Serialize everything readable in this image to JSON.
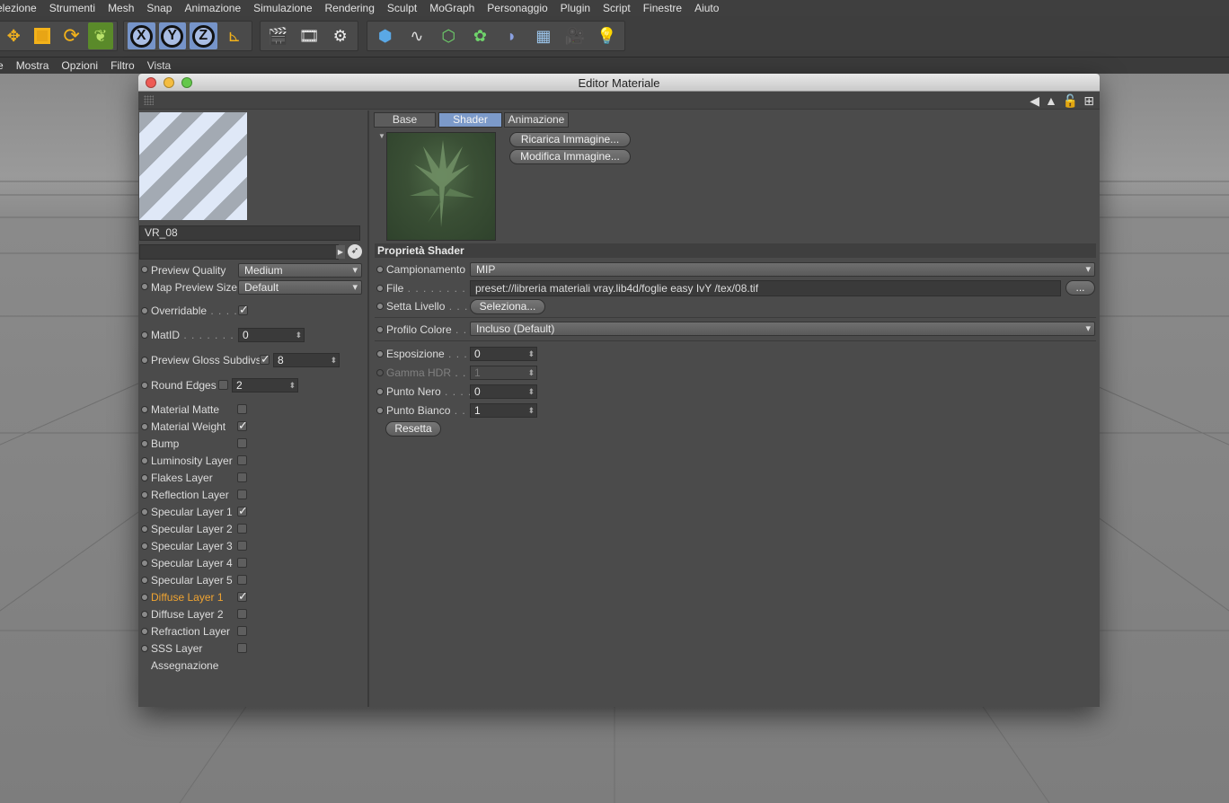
{
  "menubar": [
    "elezione",
    "Strumenti",
    "Mesh",
    "Snap",
    "Animazione",
    "Simulazione",
    "Rendering",
    "Sculpt",
    "MoGraph",
    "Personaggio",
    "Plugin",
    "Script",
    "Finestre",
    "Aiuto"
  ],
  "submenu": [
    "e",
    "Mostra",
    "Opzioni",
    "Filtro",
    "Vista"
  ],
  "toolbar": {
    "axis_x": "X",
    "axis_y": "Y",
    "axis_z": "Z"
  },
  "window": {
    "title": "Editor Materiale"
  },
  "material": {
    "name": "VR_08",
    "search_value": ""
  },
  "left": {
    "preview_quality_label": "Preview Quality",
    "preview_quality_value": "Medium",
    "map_preview_size_label": "Map Preview Size",
    "map_preview_size_value": "Default",
    "overridable_label": "Overridable",
    "matid_label": "MatID",
    "matid_value": "0",
    "preview_gloss_label": "Preview Gloss Subdivs",
    "preview_gloss_value": "8",
    "round_edges_label": "Round Edges",
    "round_edges_value": "2",
    "layers": [
      {
        "label": "Material Matte",
        "checked": false
      },
      {
        "label": "Material Weight",
        "checked": true
      },
      {
        "label": "Bump",
        "checked": false
      },
      {
        "label": "Luminosity Layer",
        "checked": false
      },
      {
        "label": "Flakes Layer",
        "checked": false
      },
      {
        "label": "Reflection Layer",
        "checked": false
      },
      {
        "label": "Specular Layer 1",
        "checked": true
      },
      {
        "label": "Specular Layer 2",
        "checked": false
      },
      {
        "label": "Specular Layer 3",
        "checked": false
      },
      {
        "label": "Specular Layer 4",
        "checked": false
      },
      {
        "label": "Specular Layer 5",
        "checked": false
      },
      {
        "label": "Diffuse Layer 1",
        "checked": true
      },
      {
        "label": "Diffuse Layer 2",
        "checked": false
      },
      {
        "label": "Refraction Layer",
        "checked": false
      },
      {
        "label": "SSS Layer",
        "checked": false
      }
    ],
    "assignment_label": "Assegnazione"
  },
  "tabs": [
    "Base",
    "Shader",
    "Animazione"
  ],
  "shader": {
    "reload_image": "Ricarica Immagine...",
    "edit_image": "Modifica Immagine...",
    "section_title": "Proprietà Shader",
    "sampling_label": "Campionamento",
    "sampling_value": "MIP",
    "file_label": "File",
    "file_value": "preset://libreria materiali vray.lib4d/foglie easy IvY /tex/08.tif",
    "browse_button": "...",
    "set_level_label": "Setta Livello",
    "select_button": "Seleziona...",
    "color_profile_label": "Profilo Colore",
    "color_profile_value": "Incluso (Default)",
    "exposure_label": "Esposizione",
    "exposure_value": "0",
    "gamma_label": "Gamma HDR",
    "gamma_value": "1",
    "black_point_label": "Punto Nero",
    "black_point_value": "0",
    "white_point_label": "Punto Bianco",
    "white_point_value": "1",
    "reset_button": "Resetta"
  },
  "colors": {
    "accent_tab": "#7c9ac9",
    "highlight_label": "#f0a431",
    "panel_bg": "#4b4b4b"
  }
}
